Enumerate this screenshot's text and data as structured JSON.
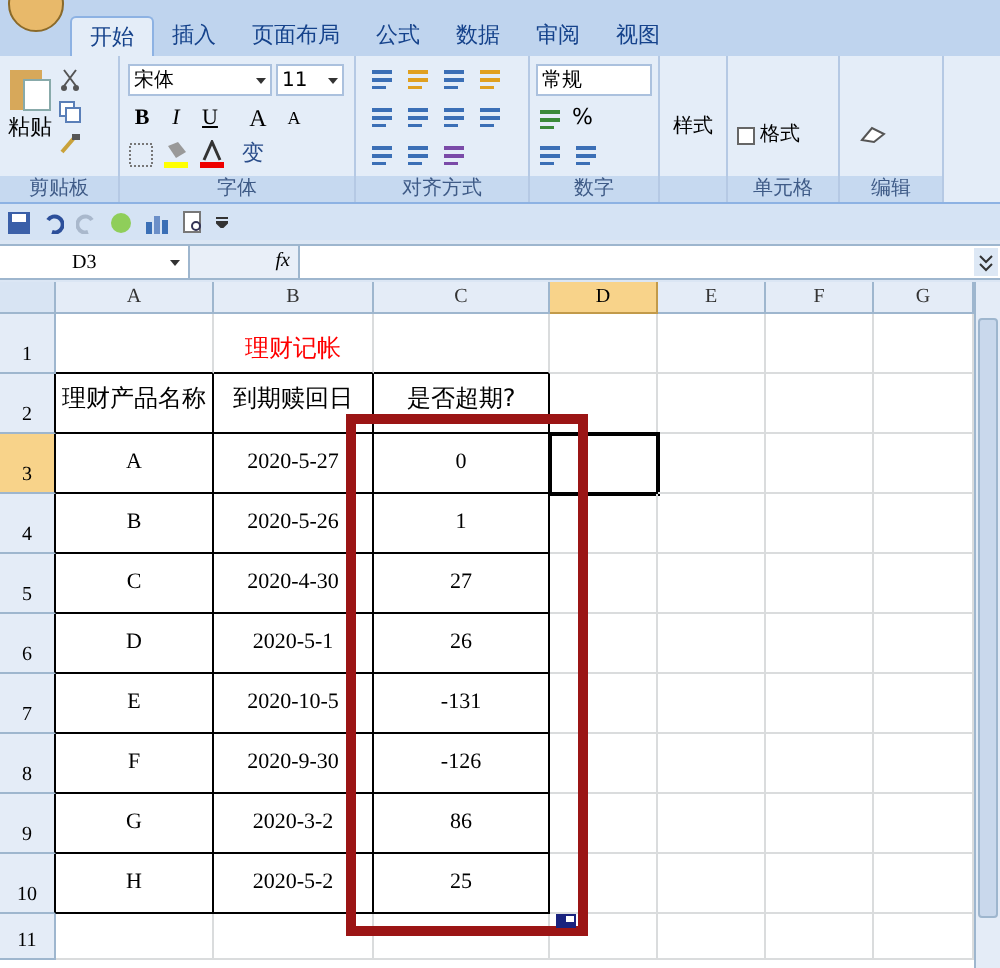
{
  "tabs": [
    {
      "label": "开始",
      "selected": true
    },
    {
      "label": "插入",
      "selected": false
    },
    {
      "label": "页面布局",
      "selected": false
    },
    {
      "label": "公式",
      "selected": false
    },
    {
      "label": "数据",
      "selected": false
    },
    {
      "label": "审阅",
      "selected": false
    },
    {
      "label": "视图",
      "selected": false
    }
  ],
  "ribbon": {
    "clipboard": {
      "paste": "粘贴",
      "label": "剪贴板"
    },
    "font": {
      "name": "宋体",
      "size": "11",
      "bold": "B",
      "italic": "I",
      "underline": "U",
      "grow": "A",
      "shrink": "A",
      "phonetic": "变",
      "label": "字体"
    },
    "alignment": {
      "label": "对齐方式"
    },
    "number": {
      "format": "常规",
      "percent": "%",
      "label": "数字"
    },
    "styles": {
      "button": "样式"
    },
    "cells": {
      "format": "格式",
      "label": "单元格"
    },
    "editing": {
      "label": "编辑"
    }
  },
  "formula_bar": {
    "name_box": "D3",
    "fx": "fx"
  },
  "columns": [
    {
      "label": "A",
      "selected": false
    },
    {
      "label": "B",
      "selected": false
    },
    {
      "label": "C",
      "selected": false
    },
    {
      "label": "D",
      "selected": true
    },
    {
      "label": "E",
      "selected": false
    },
    {
      "label": "F",
      "selected": false
    },
    {
      "label": "G",
      "selected": false
    }
  ],
  "rows": [
    {
      "number": "1",
      "selected": false,
      "title": "理财记帐"
    },
    {
      "number": "2",
      "selected": false,
      "cells": [
        "理财产品名称",
        "到期赎回日",
        "是否超期?"
      ]
    },
    {
      "number": "3",
      "selected": true,
      "cells": [
        "A",
        "2020-5-27",
        "0"
      ]
    },
    {
      "number": "4",
      "selected": false,
      "cells": [
        "B",
        "2020-5-26",
        "1"
      ]
    },
    {
      "number": "5",
      "selected": false,
      "cells": [
        "C",
        "2020-4-30",
        "27"
      ]
    },
    {
      "number": "6",
      "selected": false,
      "cells": [
        "D",
        "2020-5-1",
        "26"
      ]
    },
    {
      "number": "7",
      "selected": false,
      "cells": [
        "E",
        "2020-10-5",
        "-131"
      ]
    },
    {
      "number": "8",
      "selected": false,
      "cells": [
        "F",
        "2020-9-30",
        "-126"
      ]
    },
    {
      "number": "9",
      "selected": false,
      "cells": [
        "G",
        "2020-3-2",
        "86"
      ]
    },
    {
      "number": "10",
      "selected": false,
      "cells": [
        "H",
        "2020-5-2",
        "25"
      ]
    },
    {
      "number": "11",
      "selected": false
    }
  ]
}
